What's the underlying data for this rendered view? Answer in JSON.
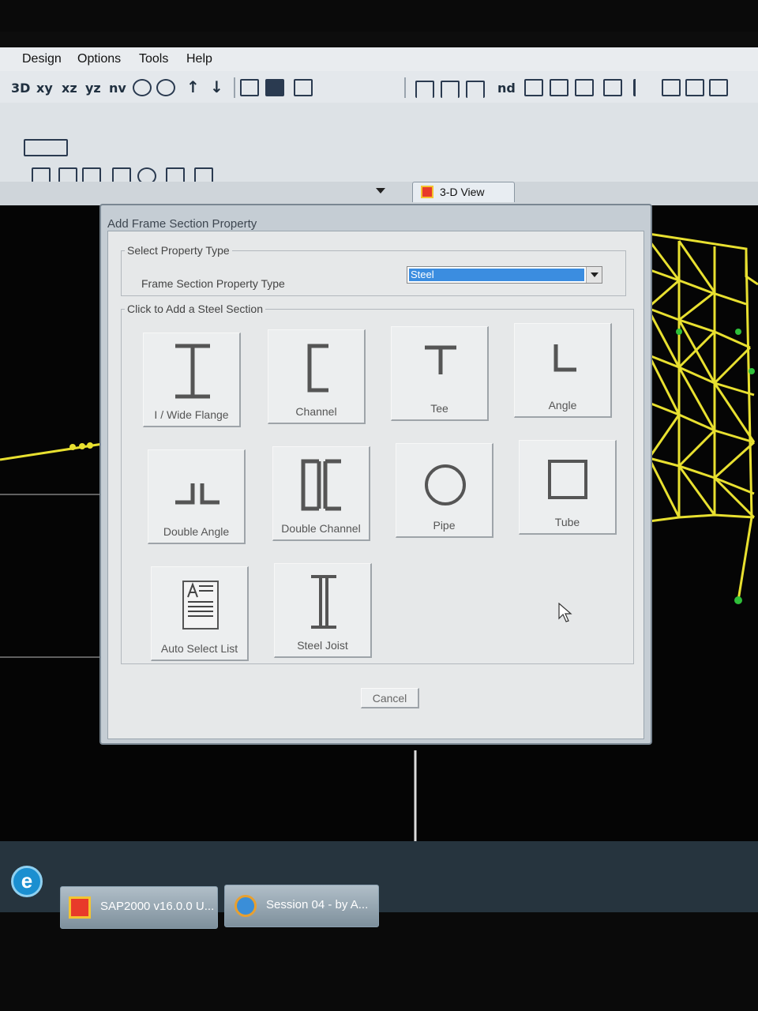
{
  "menu": {
    "items": [
      "Design",
      "Options",
      "Tools",
      "Help"
    ]
  },
  "toolbar": {
    "view_buttons": [
      "3D",
      "xy",
      "xz",
      "yz",
      "nv"
    ],
    "nd_label": "nd"
  },
  "tabs": {
    "active_view": "3-D View"
  },
  "dialog": {
    "title": "Add Frame Section Property",
    "select_group_legend": "Select Property Type",
    "property_type_label": "Frame Section Property Type",
    "property_type_value": "Steel",
    "sections_group_legend": "Click to Add a Steel Section",
    "sections": [
      {
        "label": "I / Wide Flange",
        "icon": "i-beam-icon"
      },
      {
        "label": "Channel",
        "icon": "channel-icon"
      },
      {
        "label": "Tee",
        "icon": "tee-icon"
      },
      {
        "label": "Angle",
        "icon": "angle-icon"
      },
      {
        "label": "Double Angle",
        "icon": "double-angle-icon"
      },
      {
        "label": "Double Channel",
        "icon": "double-channel-icon"
      },
      {
        "label": "Pipe",
        "icon": "pipe-icon"
      },
      {
        "label": "Tube",
        "icon": "tube-icon"
      },
      {
        "label": "Auto Select List",
        "icon": "auto-select-list-icon"
      },
      {
        "label": "Steel Joist",
        "icon": "steel-joist-icon"
      }
    ],
    "cancel_label": "Cancel"
  },
  "taskbar": {
    "items": [
      {
        "label": "SAP2000 v16.0.0 U...",
        "icon": "sap2000-icon"
      },
      {
        "label": "Session 04 - by A...",
        "icon": "media-player-icon"
      }
    ]
  },
  "colors": {
    "structure": "#e8e030",
    "support": "#2fbf3a",
    "selection": "#3b8de0"
  }
}
